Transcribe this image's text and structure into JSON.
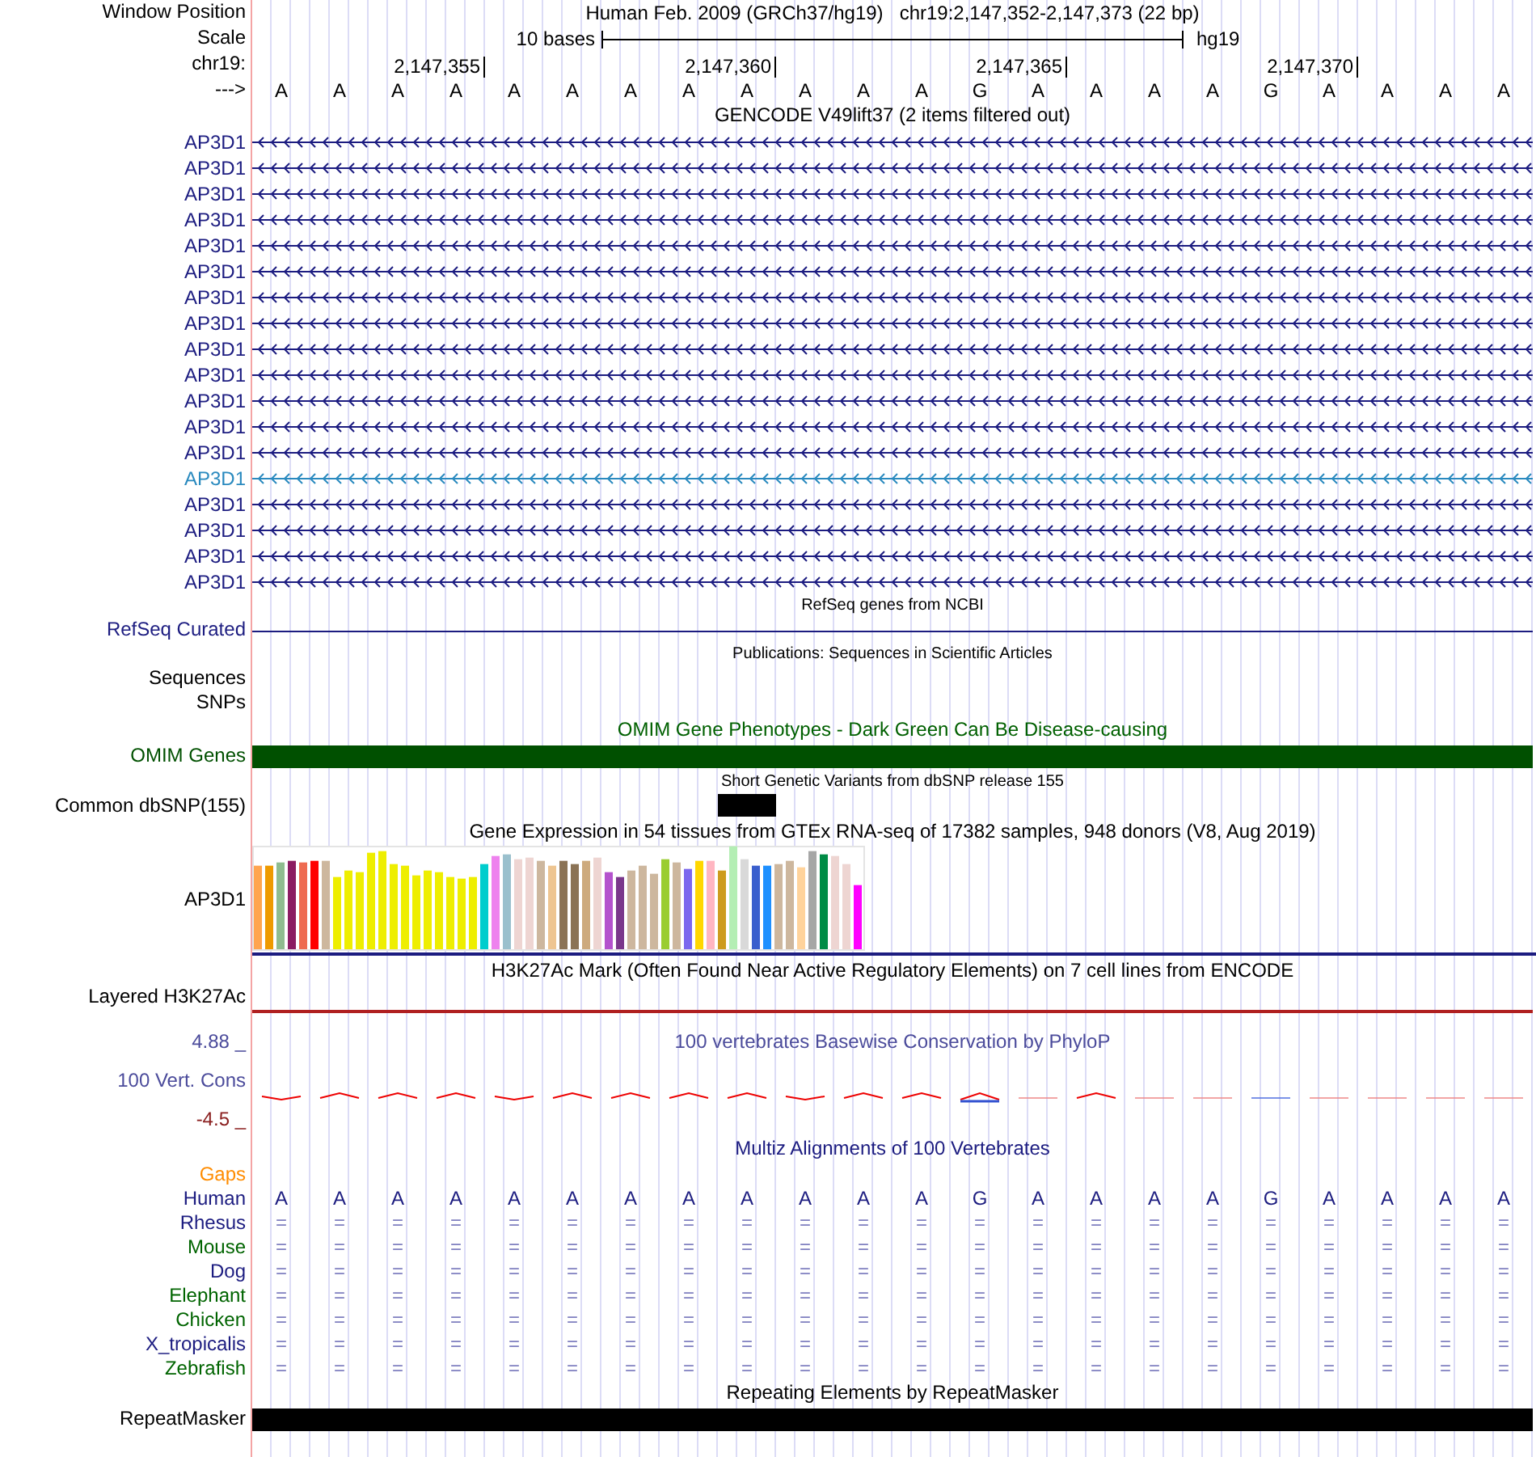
{
  "header": {
    "window_position_label": "Window Position",
    "assembly": "Human Feb. 2009 (GRCh37/hg19)",
    "position": "chr19:2,147,352-2,147,373 (22 bp)",
    "scale_label": "Scale",
    "scale_text": "10 bases",
    "scale_db": "hg19",
    "chrom_label": "chr19:",
    "strand_label": "--->"
  },
  "bases": [
    {
      "base": "A"
    },
    {
      "base": "A"
    },
    {
      "base": "A"
    },
    {
      "base": "A",
      "tick": "2,147,355"
    },
    {
      "base": "A"
    },
    {
      "base": "A"
    },
    {
      "base": "A"
    },
    {
      "base": "A"
    },
    {
      "base": "A",
      "tick": "2,147,360"
    },
    {
      "base": "A"
    },
    {
      "base": "A"
    },
    {
      "base": "A"
    },
    {
      "base": "G"
    },
    {
      "base": "A",
      "tick": "2,147,365"
    },
    {
      "base": "A"
    },
    {
      "base": "A"
    },
    {
      "base": "A"
    },
    {
      "base": "G"
    },
    {
      "base": "A",
      "tick": "2,147,370"
    },
    {
      "base": "A"
    },
    {
      "base": "A"
    },
    {
      "base": "A"
    }
  ],
  "tracks": [
    {
      "kind": "gene",
      "title": {
        "text": "GENCODE V49lift37 (2 items filtered out)"
      },
      "items": [
        {
          "name": "AP3D1",
          "selected": false
        },
        {
          "name": "AP3D1",
          "selected": false
        },
        {
          "name": "AP3D1",
          "selected": false
        },
        {
          "name": "AP3D1",
          "selected": false
        },
        {
          "name": "AP3D1",
          "selected": false
        },
        {
          "name": "AP3D1",
          "selected": false
        },
        {
          "name": "AP3D1",
          "selected": false
        },
        {
          "name": "AP3D1",
          "selected": false
        },
        {
          "name": "AP3D1",
          "selected": false
        },
        {
          "name": "AP3D1",
          "selected": false
        },
        {
          "name": "AP3D1",
          "selected": false
        },
        {
          "name": "AP3D1",
          "selected": false
        },
        {
          "name": "AP3D1",
          "selected": false
        },
        {
          "name": "AP3D1",
          "selected": true
        },
        {
          "name": "AP3D1",
          "selected": false
        },
        {
          "name": "AP3D1",
          "selected": false
        },
        {
          "name": "AP3D1",
          "selected": false
        },
        {
          "name": "AP3D1",
          "selected": false
        }
      ]
    },
    {
      "kind": "line",
      "title": {
        "text": "RefSeq genes from NCBI"
      },
      "label": "RefSeq Curated",
      "color": "#1c1c80"
    },
    {
      "kind": "labels",
      "title": {
        "text": "Publications: Sequences in Scientific Articles"
      },
      "labels": [
        "Sequences",
        "SNPs"
      ]
    },
    {
      "kind": "bar",
      "title": {
        "text": "OMIM Gene Phenotypes - Dark Green Can Be Disease-causing",
        "color": "#006000"
      },
      "label": "OMIM Genes",
      "color": "#005000"
    },
    {
      "kind": "snp",
      "title": {
        "text": "Short Genetic Variants from dbSNP release 155"
      },
      "label": "Common dbSNP(155)"
    },
    {
      "kind": "expression",
      "title": {
        "text": "Gene Expression in 54 tissues from GTEx RNA-seq of 17382 samples, 948 donors (V8, Aug 2019)"
      },
      "label": "AP3D1"
    },
    {
      "kind": "signal",
      "title": {
        "text": "H3K27Ac Mark (Often Found Near Active Regulatory Elements) on 7 cell lines from ENCODE"
      },
      "label": "Layered H3K27Ac"
    },
    {
      "kind": "conservation",
      "title": {
        "text": "100 vertebrates Basewise Conservation by PhyloP",
        "color": "#4b4b9b"
      },
      "label": "100 Vert. Cons",
      "max": "4.88 _",
      "min": "-4.5 _"
    },
    {
      "kind": "alignment",
      "title": {
        "text": "Multiz Alignments of 100 Vertebrates",
        "color": "#1c1c80"
      },
      "gaps_label": "Gaps",
      "species": [
        {
          "name": "Human",
          "color": "#1c1c80",
          "cells": [
            "A",
            "A",
            "A",
            "A",
            "A",
            "A",
            "A",
            "A",
            "A",
            "A",
            "A",
            "A",
            "G",
            "A",
            "A",
            "A",
            "A",
            "G",
            "A",
            "A",
            "A",
            "A"
          ]
        },
        {
          "name": "Rhesus",
          "color": "#1c1c80",
          "cells": [
            "=",
            "=",
            "=",
            "=",
            "=",
            "=",
            "=",
            "=",
            "=",
            "=",
            "=",
            "=",
            "=",
            "=",
            "=",
            "=",
            "=",
            "=",
            "=",
            "=",
            "=",
            "="
          ]
        },
        {
          "name": "Mouse",
          "color": "#006400",
          "cells": [
            "=",
            "=",
            "=",
            "=",
            "=",
            "=",
            "=",
            "=",
            "=",
            "=",
            "=",
            "=",
            "=",
            "=",
            "=",
            "=",
            "=",
            "=",
            "=",
            "=",
            "=",
            "="
          ]
        },
        {
          "name": "Dog",
          "color": "#1c1c80",
          "cells": [
            "=",
            "=",
            "=",
            "=",
            "=",
            "=",
            "=",
            "=",
            "=",
            "=",
            "=",
            "=",
            "=",
            "=",
            "=",
            "=",
            "=",
            "=",
            "=",
            "=",
            "=",
            "="
          ]
        },
        {
          "name": "Elephant",
          "color": "#006400",
          "cells": [
            "=",
            "=",
            "=",
            "=",
            "=",
            "=",
            "=",
            "=",
            "=",
            "=",
            "=",
            "=",
            "=",
            "=",
            "=",
            "=",
            "=",
            "=",
            "=",
            "=",
            "=",
            "="
          ]
        },
        {
          "name": "Chicken",
          "color": "#006400",
          "cells": [
            "=",
            "=",
            "=",
            "=",
            "=",
            "=",
            "=",
            "=",
            "=",
            "=",
            "=",
            "=",
            "=",
            "=",
            "=",
            "=",
            "=",
            "=",
            "=",
            "=",
            "=",
            "="
          ]
        },
        {
          "name": "X_tropicalis",
          "color": "#1c1c80",
          "cells": [
            "=",
            "=",
            "=",
            "=",
            "=",
            "=",
            "=",
            "=",
            "=",
            "=",
            "=",
            "=",
            "=",
            "=",
            "=",
            "=",
            "=",
            "=",
            "=",
            "=",
            "=",
            "="
          ]
        },
        {
          "name": "Zebrafish",
          "color": "#006400",
          "cells": [
            "=",
            "=",
            "=",
            "=",
            "=",
            "=",
            "=",
            "=",
            "=",
            "=",
            "=",
            "=",
            "=",
            "=",
            "=",
            "=",
            "=",
            "=",
            "=",
            "=",
            "=",
            "="
          ]
        }
      ]
    },
    {
      "kind": "bar",
      "title": {
        "text": "Repeating Elements by RepeatMasker"
      },
      "label": "RepeatMasker",
      "color": "#000000"
    }
  ]
}
